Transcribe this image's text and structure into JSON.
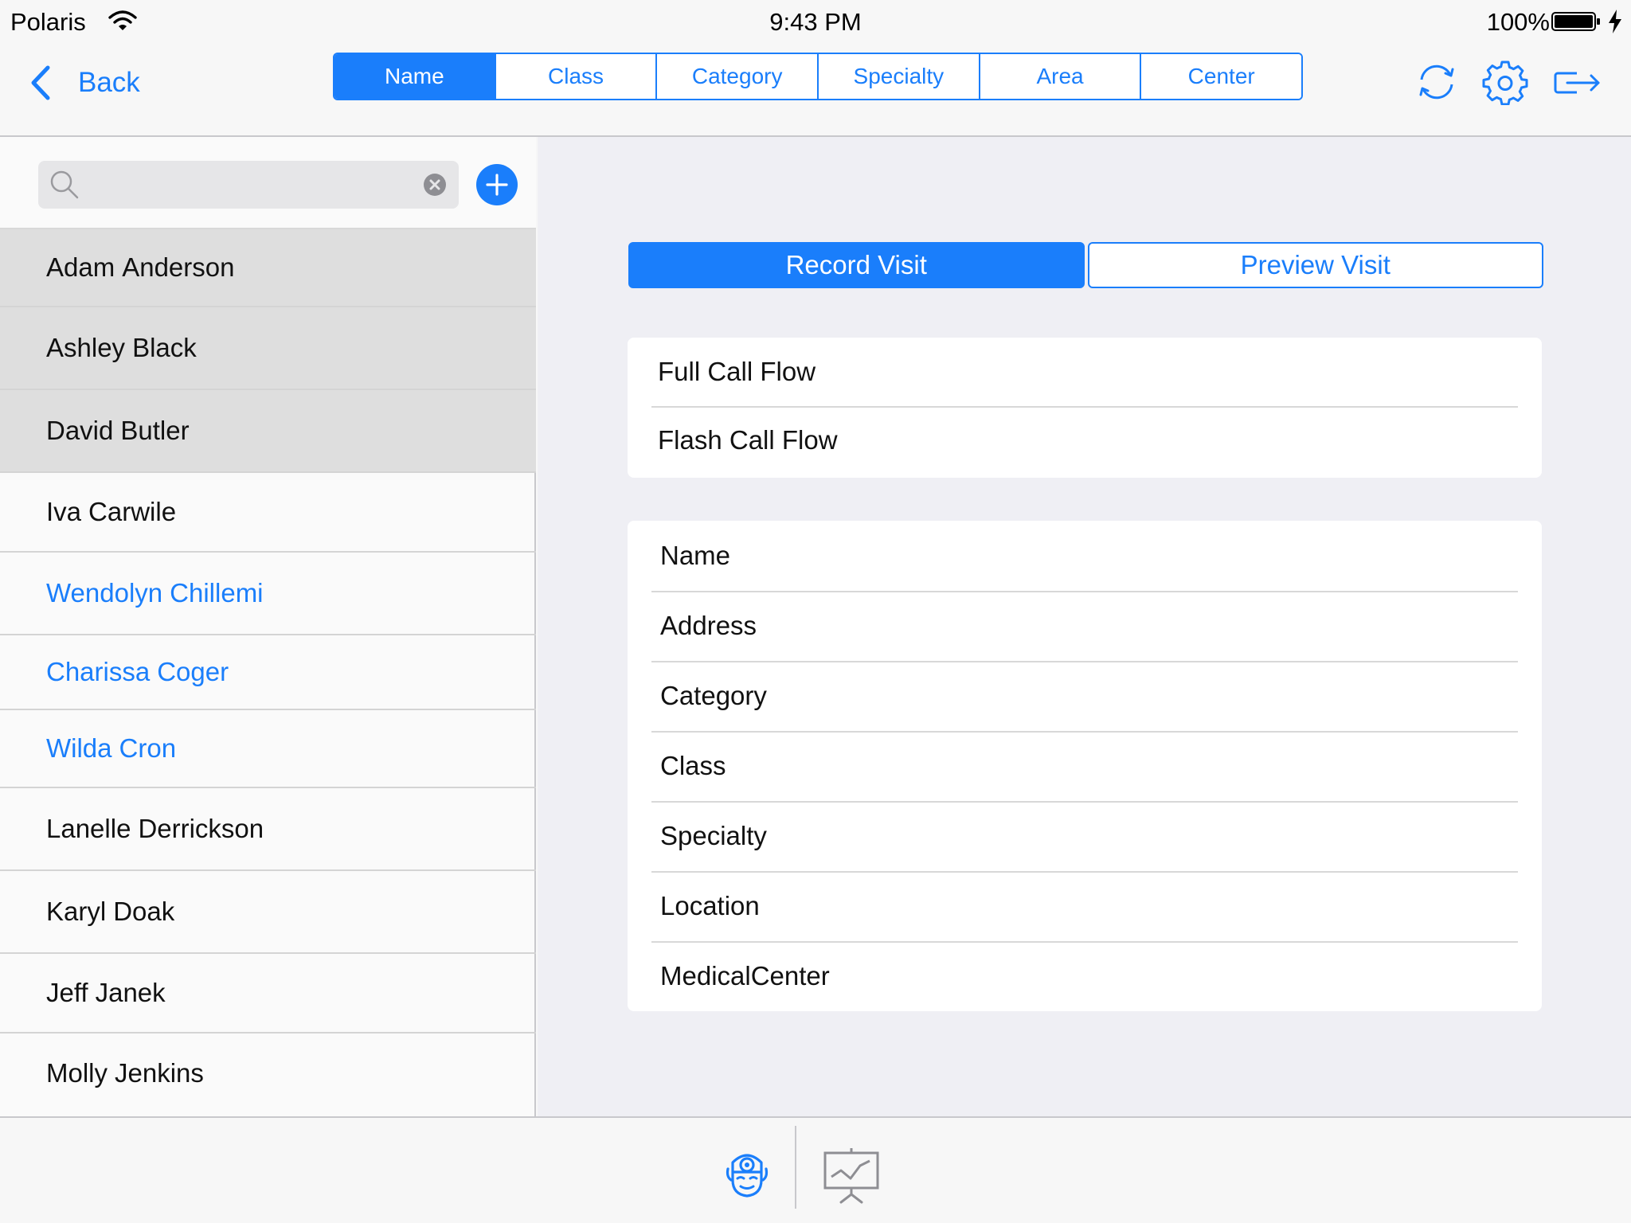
{
  "status_bar": {
    "carrier": "Polaris",
    "time": "9:43 PM",
    "battery": "100%",
    "wifi_icon": "wifi-icon",
    "battery_icon": "battery-icon"
  },
  "nav": {
    "back_label": "Back",
    "tabs": [
      {
        "label": "Name",
        "active": true
      },
      {
        "label": "Class",
        "active": false
      },
      {
        "label": "Category",
        "active": false
      },
      {
        "label": "Specialty",
        "active": false
      },
      {
        "label": "Area",
        "active": false
      },
      {
        "label": "Center",
        "active": false
      }
    ],
    "icons": [
      "sync-icon",
      "gear-icon",
      "logout-icon"
    ]
  },
  "search": {
    "value": "",
    "placeholder": ""
  },
  "doctors": [
    {
      "first": "Adam",
      "last": "Anderson",
      "state": "selected"
    },
    {
      "first": "Ashley",
      "last": "Black",
      "state": "selected"
    },
    {
      "first": "David",
      "last": "Butler",
      "state": "selected"
    },
    {
      "first": "Iva",
      "last": "Carwile",
      "state": "normal"
    },
    {
      "first": "Wendolyn",
      "last": "Chillemi",
      "state": "link"
    },
    {
      "first": "Charissa",
      "last": "Coger",
      "state": "link"
    },
    {
      "first": "Wilda",
      "last": "Cron",
      "state": "link"
    },
    {
      "first": "Lanelle",
      "last": "Derrickson",
      "state": "normal"
    },
    {
      "first": "Karyl",
      "last": "Doak",
      "state": "normal"
    },
    {
      "first": "Jeff",
      "last": "Janek",
      "state": "normal"
    },
    {
      "first": "Molly",
      "last": "Jenkins",
      "state": "normal"
    }
  ],
  "visit": {
    "record_label": "Record Visit",
    "preview_label": "Preview Visit"
  },
  "call_flows": [
    "Full Call Flow",
    "Flash Call Flow"
  ],
  "fields": [
    "Name",
    "Address",
    "Category",
    "Class",
    "Specialty",
    "Location",
    "MedicalCenter"
  ],
  "tabbar": {
    "icons": [
      "doctor-icon",
      "presentation-icon"
    ]
  },
  "colors": {
    "accent": "#1a7efb",
    "selected_row": "#dedede",
    "pane_bg": "#efeff4"
  }
}
